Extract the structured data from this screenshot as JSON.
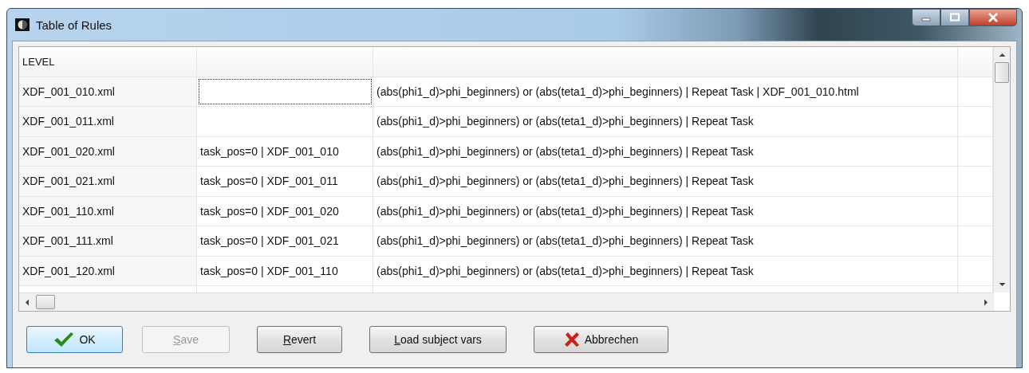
{
  "window": {
    "title": "Table of Rules"
  },
  "table": {
    "columns": [
      "LEVEL"
    ],
    "rows": [
      {
        "column_1": "XDF_001_010.xml",
        "column_2_focused": true,
        "column_3": "(abs(phi1_d)>phi_beginners) or (abs(teta1_d)>phi_beginners) | Repeat Task | XDF_001_010.html"
      },
      {
        "column_1": "XDF_001_011.xml",
        "column_2_focused": false,
        "column_3": "(abs(phi1_d)>phi_beginners) or (abs(teta1_d)>phi_beginners) | Repeat Task"
      },
      {
        "column_1": "XDF_001_020.xml",
        "column_2": "task_pos=0 | XDF_001_010",
        "column_2_focused": false,
        "column_3": "(abs(phi1_d)>phi_beginners) or (abs(teta1_d)>phi_beginners) | Repeat Task"
      },
      {
        "column_1": "XDF_001_021.xml",
        "column_2": "task_pos=0 | XDF_001_011",
        "column_2_focused": false,
        "column_3": "(abs(phi1_d)>phi_beginners) or (abs(teta1_d)>phi_beginners) | Repeat Task"
      },
      {
        "column_1": "XDF_001_110.xml",
        "column_2": "task_pos=0 | XDF_001_020",
        "column_2_focused": false,
        "column_3": "(abs(phi1_d)>phi_beginners) or (abs(teta1_d)>phi_beginners) | Repeat Task"
      },
      {
        "column_1": "XDF_001_111.xml",
        "column_2": "task_pos=0 | XDF_001_021",
        "column_2_focused": false,
        "column_3": "(abs(phi1_d)>phi_beginners) or (abs(teta1_d)>phi_beginners) | Repeat Task"
      },
      {
        "column_1": "XDF_001_120.xml",
        "column_2": "task_pos=0 | XDF_001_110",
        "column_2_focused": false,
        "column_3": "(abs(phi1_d)>phi_beginners) or (abs(teta1_d)>phi_beginners) | Repeat Task"
      }
    ]
  },
  "buttons": [
    {
      "kind": "ok",
      "label": "OK",
      "disabled": false,
      "mnemonic": false,
      "default": true
    },
    {
      "kind": "plain",
      "label": "Save",
      "disabled": true,
      "mnemonic": true,
      "default": false
    },
    {
      "kind": "plain",
      "label": "Revert",
      "disabled": false,
      "mnemonic": true,
      "default": false
    },
    {
      "kind": "plain",
      "label": "Load subject vars",
      "disabled": false,
      "mnemonic": true,
      "default": false
    },
    {
      "kind": "cancel",
      "label": "Abbrechen",
      "disabled": false,
      "mnemonic": false,
      "default": false
    }
  ]
}
